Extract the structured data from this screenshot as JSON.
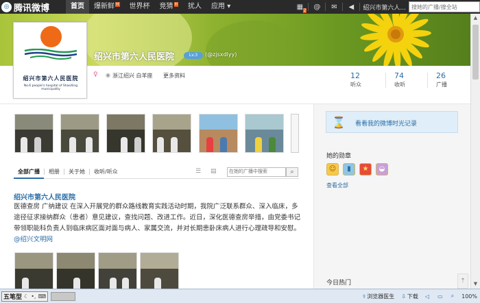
{
  "topnav": {
    "logo_text": "腾讯微博",
    "items": [
      {
        "label": "首页",
        "active": true,
        "badge": ""
      },
      {
        "label": "爆新鲜",
        "active": false,
        "badge": "H"
      },
      {
        "label": "世界杯",
        "active": false,
        "badge": ""
      },
      {
        "label": "竞猜",
        "active": false,
        "badge": "H"
      },
      {
        "label": "扰人",
        "active": false,
        "badge": ""
      },
      {
        "label": "应用 ▾",
        "active": false,
        "badge": ""
      }
    ],
    "notif_count": "2",
    "user_name": "绍兴市第六人...",
    "search_placeholder": "搜她的广播/搜全站"
  },
  "profile": {
    "name": "绍兴市第六人民医院",
    "level": "Lv.3",
    "handle": "(@zjsxdlyy)",
    "avatar_name": "绍兴市第六人民医院",
    "avatar_sub": "No.6 people's hospital of ShaoXing municipality",
    "location": "浙江绍兴 白羊座",
    "more_info": "更多资料",
    "stats": [
      {
        "num": "12",
        "label": "听众"
      },
      {
        "num": "74",
        "label": "收听"
      },
      {
        "num": "26",
        "label": "广播"
      }
    ]
  },
  "tabs": [
    {
      "label": "全部广播",
      "active": true
    },
    {
      "label": "相册",
      "active": false
    },
    {
      "label": "关于她",
      "active": false
    },
    {
      "label": "收听/听众",
      "active": false
    }
  ],
  "feed_search_placeholder": "在她的广播中搜索",
  "post": {
    "author": "绍兴市第六人民医院",
    "text": "医德查房 广纳建议 在深入开展党的群众路线教育实践活动时期，我院广泛联系群众、深入临床，多途径征求接纳群众（患者）意见建议，查找问题、改进工作。近日，深化医德查房举措，由党委书记带领职能科负责人到临床病区面对面与病人、家属交流，并对长期患卧床病人进行心理疏导和安慰。",
    "link": "@绍兴文明网"
  },
  "sidebar": {
    "timemachine": "看看我的微博时光记录",
    "medal_title": "她的勋章",
    "see_all": "查看全部",
    "hot_title": "今日热门"
  },
  "statusbar": {
    "ime": "五笔型",
    "items": [
      "浏览器医生",
      "下载"
    ],
    "zoom": "100%"
  },
  "colors": {
    "accent": "#2b6ca6",
    "nav_bg": "#2a2a2a",
    "orange": "#ef6a16"
  }
}
